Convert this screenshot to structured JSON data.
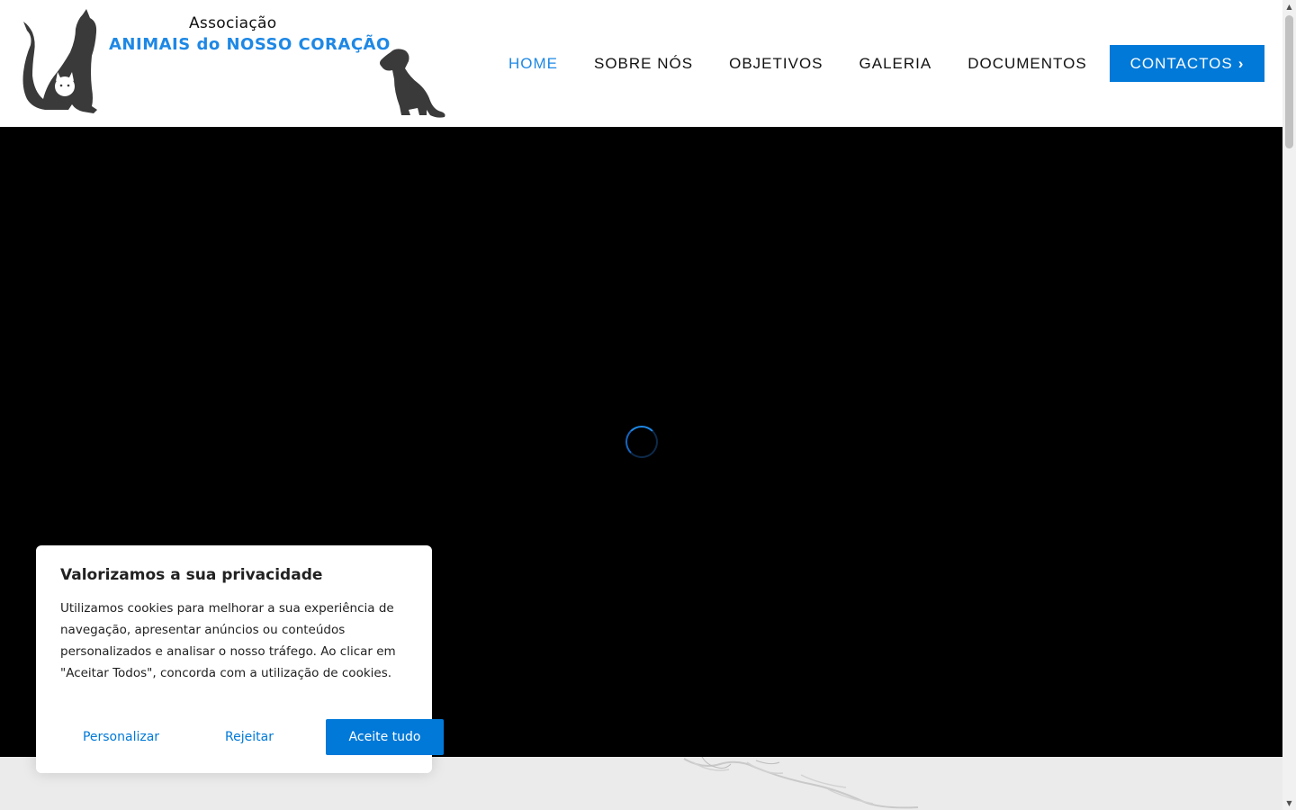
{
  "header": {
    "logo": {
      "line1": "Associação",
      "line2": "ANIMAIS do NOSSO CORAÇÃO"
    },
    "nav": [
      {
        "label": "HOME",
        "active": true
      },
      {
        "label": "SOBRE NÓS",
        "active": false
      },
      {
        "label": "OBJETIVOS",
        "active": false
      },
      {
        "label": "GALERIA",
        "active": false
      },
      {
        "label": "DOCUMENTOS",
        "active": false
      }
    ],
    "cta": {
      "label": "CONTACTOS",
      "icon": "chevron-right-icon"
    }
  },
  "hero": {
    "background": "#000000",
    "state": "loading",
    "icon": "loading-spinner-icon"
  },
  "cookie_banner": {
    "title": "Valorizamos a sua privacidade",
    "text": "Utilizamos cookies para melhorar a sua experiência de navegação, apresentar anúncios ou conteúdos personalizados e analisar o nosso tráfego. Ao clicar em \"Aceitar Todos\", concorda com a utilização de cookies.",
    "buttons": {
      "customize": "Personalizar",
      "reject": "Rejeitar",
      "accept": "Aceite tudo"
    }
  },
  "colors": {
    "accent": "#0079d8",
    "nav_active": "#1e88e5",
    "text": "#111111"
  }
}
